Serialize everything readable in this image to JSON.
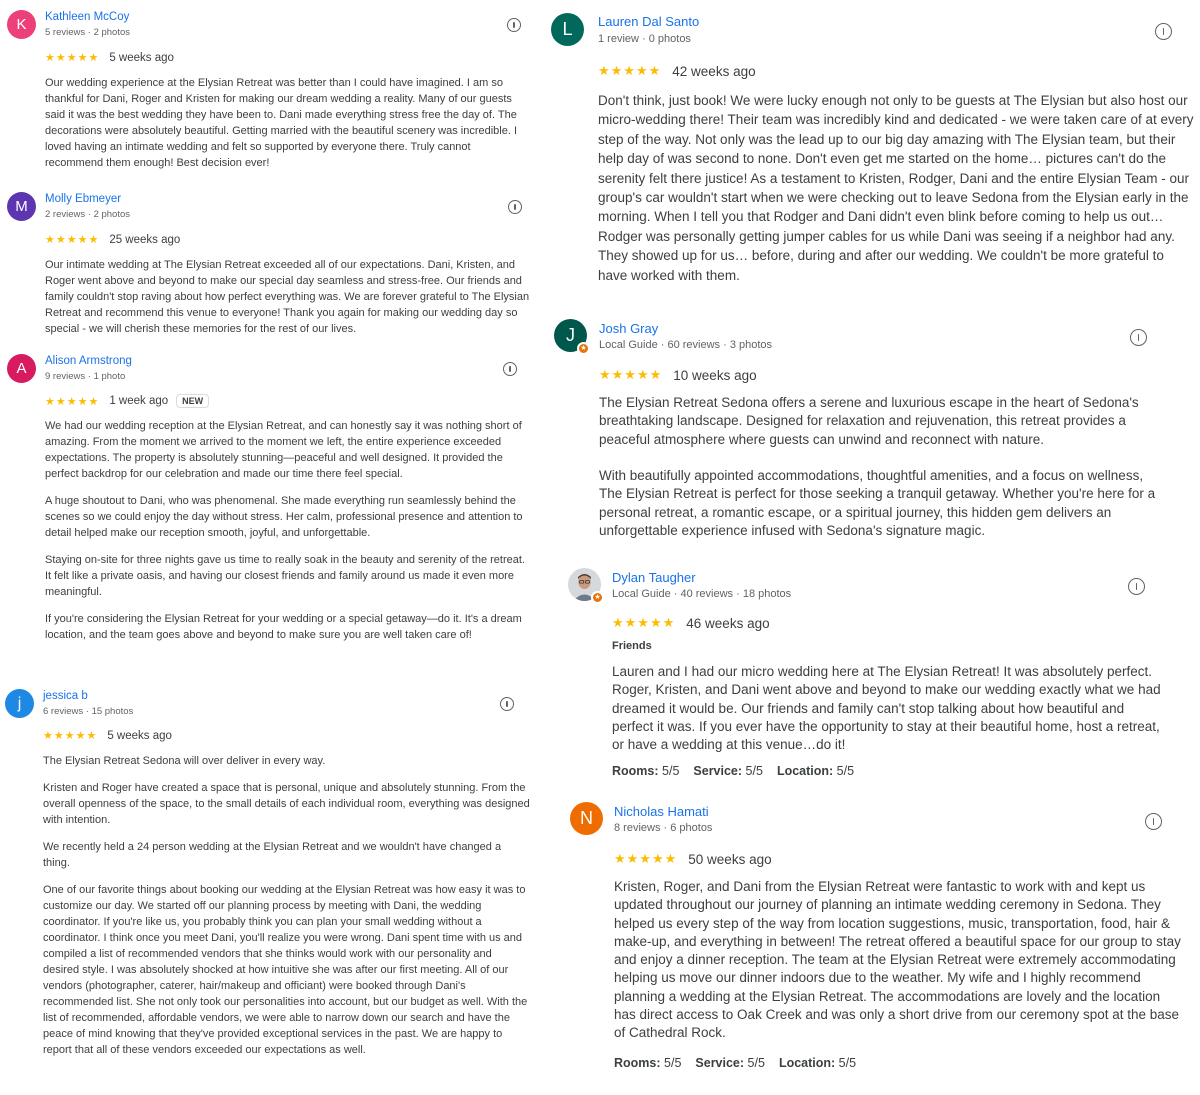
{
  "colors": {
    "link_blue": "#1a73e8",
    "star_yellow": "#fbbc04",
    "badge_orange": "#e8710a"
  },
  "reviews_left": [
    {
      "initial": "K",
      "avatar_color": "#ec407a",
      "name": "Kathleen McCoy",
      "meta": "5 reviews · 2 photos",
      "stars": "★★★★★",
      "when": "5 weeks ago",
      "paragraphs": [
        "Our wedding experience at the Elysian Retreat was better than I could have imagined. I am so thankful for Dani, Roger and Kristen for making our dream wedding a reality. Many of our guests said it was the best wedding they have been to. Dani made everything stress free the day of. The decorations were absolutely beautiful. Getting married with the beautiful scenery was incredible. I loved having an intimate wedding and felt so supported by everyone there. Truly cannot recommend them enough! Best decision ever!"
      ]
    },
    {
      "initial": "M",
      "avatar_color": "#5e35b1",
      "name": "Molly Ebmeyer",
      "meta": "2 reviews · 2 photos",
      "stars": "★★★★★",
      "when": "25 weeks ago",
      "paragraphs": [
        "Our intimate wedding at The Elysian Retreat exceeded all of our expectations. Dani, Kristen, and Roger went above and beyond to make our special day seamless and stress-free. Our friends and family couldn't stop raving about how perfect everything was. We are forever grateful to The Elysian Retreat and recommend this venue to everyone! Thank you again for making our wedding day so special - we will cherish these memories for the rest of our lives."
      ]
    },
    {
      "initial": "A",
      "avatar_color": "#d81b60",
      "name": "Alison Armstrong",
      "meta": "9 reviews · 1 photo",
      "stars": "★★★★★",
      "when": "1 week ago",
      "badge": "NEW",
      "paragraphs": [
        "We had our wedding reception at the Elysian Retreat, and can honestly say it was nothing short of amazing. From the moment we arrived to the moment we left, the entire experience exceeded expectations. The property is absolutely stunning—peaceful and well designed. It provided the perfect backdrop for our celebration and made our time there feel special.",
        "A huge shoutout to Dani, who was phenomenal. She made everything run seamlessly behind the scenes so we could enjoy the day without stress. Her calm, professional presence and attention to detail helped make our reception smooth, joyful, and unforgettable.",
        "Staying on-site for three nights gave us time to really soak in the beauty and serenity of the retreat. It felt like a private oasis, and having our closest friends and family around us made it even more meaningful.",
        "If you're considering the Elysian Retreat for your wedding or a special getaway—do it. It's a dream location, and the team goes above and beyond to make sure you are well taken care of!"
      ]
    },
    {
      "initial": "j",
      "avatar_color": "#1e88e5",
      "name": "jessica b",
      "meta": "6 reviews · 15 photos",
      "stars": "★★★★★",
      "when": "5 weeks ago",
      "paragraphs": [
        "The Elysian Retreat Sedona will over deliver in every way.",
        "Kristen and Roger have created a space that is personal, unique and absolutely stunning. From the overall openness of the space, to the small details of each individual room, everything was designed with intention.",
        "We recently held a 24 person wedding at the Elysian Retreat and we wouldn't have changed a thing.",
        "One of our favorite things about booking our wedding at the Elysian Retreat was how easy it was to customize our day. We started off our planning process by meeting with Dani, the wedding coordinator. If you're like us, you probably think you can plan your small wedding without a coordinator. I think once you meet Dani, you'll realize you were wrong. Dani spent time with us and compiled a list of recommended vendors that she thinks would work with our personality and desired style. I was absolutely shocked at how intuitive she was after our first meeting. All of our vendors (photographer, caterer, hair/makeup and officiant) were booked through Dani's recommended list. She not only took our personalities into account, but our budget as well. With the list of recommended, affordable vendors, we were able to narrow down our search and have the peace of mind knowing that they've provided exceptional services in the past. We are happy to report that all of these vendors exceeded our expectations as well."
      ]
    }
  ],
  "reviews_right": [
    {
      "initial": "L",
      "avatar_color": "#00695c",
      "name": "Lauren Dal Santo",
      "meta": "1 review · 0 photos",
      "stars": "★★★★★",
      "when": "42 weeks ago",
      "paragraphs": [
        "Don't think, just book! We were lucky enough not only to be guests at The Elysian but also host our micro-wedding there! Their team was incredibly kind and dedicated - we were taken care of at every step of the way. Not only was the lead up to our big day amazing with The Elysian team, but their help day of was second to none. Don't even get me started on the home… pictures can't do the serenity felt there justice! As a testament to Kristen, Rodger, Dani and the entire Elysian Team - our group's car wouldn't start when we were checking out to leave Sedona from the Elysian early in the morning. When I tell you that Rodger and Dani didn't even blink before coming to help us out… Rodger was personally getting jumper cables for us while Dani was seeing if a neighbor had any. They showed up for us… before, during and after our wedding. We couldn't be more grateful to have worked with them."
      ]
    },
    {
      "initial": "J",
      "avatar_color": "#00574b",
      "name": "Josh Gray",
      "meta": "Local Guide · 60 reviews · 3 photos",
      "local_guide_badge": "★",
      "stars": "★★★★★",
      "when": "10 weeks ago",
      "paragraphs": [
        "The Elysian Retreat Sedona offers a serene and luxurious escape in the heart of Sedona's breathtaking landscape. Designed for relaxation and rejuvenation, this retreat provides a peaceful atmosphere where guests can unwind and reconnect with nature.",
        "With beautifully appointed accommodations, thoughtful amenities, and a focus on wellness, The Elysian Retreat is perfect for those seeking a tranquil getaway. Whether you're here for a personal retreat, a romantic escape, or a spiritual journey, this hidden gem delivers an unforgettable experience infused with Sedona's signature magic."
      ]
    },
    {
      "name": "Dylan Taugher",
      "meta": "Local Guide · 40 reviews · 18 photos",
      "local_guide_badge": "★",
      "stars": "★★★★★",
      "when": "46 weeks ago",
      "tag": "Friends",
      "paragraphs": [
        "Lauren and I had our micro wedding here at The Elysian Retreat! It was absolutely perfect. Roger, Kristen, and Dani went above and beyond to make our wedding exactly what we had dreamed it would be. Our friends and family can't stop talking about how beautiful and perfect it was. If you ever have the opportunity to stay at their beautiful home, host a retreat, or have a wedding at this venue…do it!"
      ],
      "scores": [
        {
          "label": "Rooms:",
          "value": "5/5"
        },
        {
          "label": "Service:",
          "value": "5/5"
        },
        {
          "label": "Location:",
          "value": "5/5"
        }
      ]
    },
    {
      "initial": "N",
      "avatar_color": "#ef6c00",
      "name": "Nicholas Hamati",
      "meta": "8 reviews · 6 photos",
      "stars": "★★★★★",
      "when": "50 weeks ago",
      "paragraphs": [
        "Kristen, Roger, and Dani from the Elysian Retreat were fantastic to work with and kept us updated throughout our journey of planning an intimate wedding ceremony in Sedona. They helped us every step of the way from location suggestions, music, transportation, food, hair & make-up, and everything in between! The retreat offered a beautiful space for our group to stay and enjoy a dinner reception. The team at the Elysian Retreat were extremely accommodating helping us move our dinner indoors due to the weather. My wife and I highly recommend planning a wedding at the Elysian Retreat. The accommodations are lovely and the location has direct access to Oak Creek and was only a short drive from our ceremony spot at the base of Cathedral Rock."
      ],
      "scores": [
        {
          "label": "Rooms:",
          "value": "5/5"
        },
        {
          "label": "Service:",
          "value": "5/5"
        },
        {
          "label": "Location:",
          "value": "5/5"
        }
      ]
    }
  ]
}
